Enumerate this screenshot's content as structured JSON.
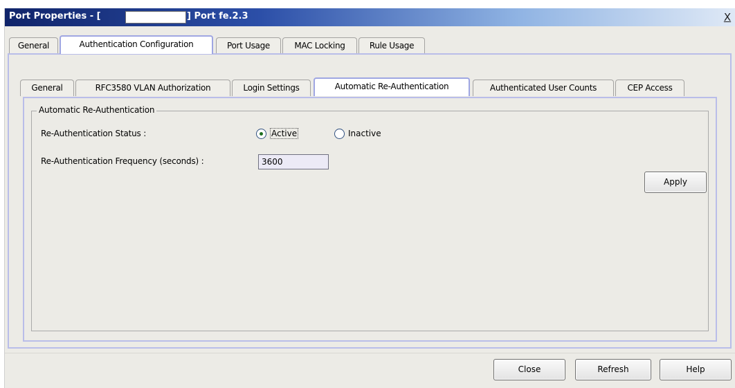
{
  "window": {
    "title_prefix": "Port Properties - [",
    "title_suffix": "] Port fe.2.3",
    "close_label": "X"
  },
  "main_tabs": [
    {
      "label": "General",
      "selected": false
    },
    {
      "label": "Authentication Configuration",
      "selected": true
    },
    {
      "label": "Port Usage",
      "selected": false
    },
    {
      "label": "MAC Locking",
      "selected": false
    },
    {
      "label": "Rule Usage",
      "selected": false
    }
  ],
  "sub_tabs": [
    {
      "label": "General",
      "selected": false
    },
    {
      "label": "RFC3580 VLAN Authorization",
      "selected": false
    },
    {
      "label": "Login Settings",
      "selected": false
    },
    {
      "label": "Automatic Re-Authentication",
      "selected": true
    },
    {
      "label": "Authenticated User Counts",
      "selected": false
    },
    {
      "label": "CEP Access",
      "selected": false
    }
  ],
  "group": {
    "title": "Automatic Re-Authentication",
    "status_label": "Re-Authentication Status :",
    "status_options": [
      {
        "label": "Active",
        "checked": true
      },
      {
        "label": "Inactive",
        "checked": false
      }
    ],
    "frequency_label": "Re-Authentication Frequency (seconds) :",
    "frequency_value": "3600",
    "apply_label": "Apply"
  },
  "footer": {
    "close_label": "Close",
    "refresh_label": "Refresh",
    "help_label": "Help"
  },
  "colors": {
    "title_bar_start": "#10246a",
    "selected_tab_border": "#9fa6e2",
    "dialog_background": "#ecebe6"
  }
}
